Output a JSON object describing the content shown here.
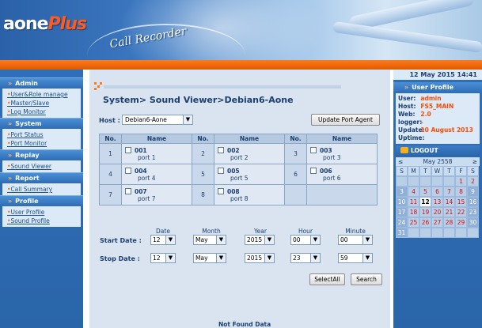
{
  "header": {
    "logo_main": "aone",
    "logo_accent": "Plus",
    "app_title": "Call Recorder",
    "accent_color": "#ff6a00",
    "brand_blue": "#2a65a9"
  },
  "sidebar": {
    "sections": [
      {
        "title": "Admin",
        "links": [
          "User&Role manage",
          "Master/Slave",
          "Log Monitor"
        ]
      },
      {
        "title": "System",
        "links": [
          "Port Status",
          "Port Monitor"
        ]
      },
      {
        "title": "Replay",
        "links": [
          "Sound Viewer"
        ]
      },
      {
        "title": "Report",
        "links": [
          "Call Summary"
        ]
      },
      {
        "title": "Profile",
        "links": [
          "User Profile",
          "Sound Profile"
        ]
      }
    ]
  },
  "main": {
    "breadcrumb": "System> Sound Viewer>Debian6-Aone",
    "host_label": "Host :",
    "host_value": "Debian6-Aone",
    "update_button": "Update Port Agent",
    "table": {
      "col_no": "No.",
      "col_name": "Name",
      "ports": [
        {
          "no": "1",
          "code": "001",
          "label": "port 1"
        },
        {
          "no": "2",
          "code": "002",
          "label": "port 2"
        },
        {
          "no": "3",
          "code": "003",
          "label": "port 3"
        },
        {
          "no": "4",
          "code": "004",
          "label": "port 4"
        },
        {
          "no": "5",
          "code": "005",
          "label": "port 5"
        },
        {
          "no": "6",
          "code": "006",
          "label": "port 6"
        },
        {
          "no": "7",
          "code": "007",
          "label": "port 7"
        },
        {
          "no": "8",
          "code": "008",
          "label": "port 8"
        }
      ]
    },
    "date_headers": {
      "date": "Date",
      "month": "Month",
      "year": "Year",
      "hour": "Hour",
      "minute": "Minute"
    },
    "start": {
      "label": "Start Date :",
      "date": "12",
      "month": "May",
      "year": "2015",
      "hour": "00",
      "minute": "00"
    },
    "stop": {
      "label": "Stop Date :",
      "date": "12",
      "month": "May",
      "year": "2015",
      "hour": "23",
      "minute": "59"
    },
    "select_all_button": "SelectAll",
    "search_button": "Search",
    "not_found": "Not Found Data"
  },
  "rightbar": {
    "date_time": "12 May 2015 14:41",
    "profile_title": "User Profile",
    "profile": [
      {
        "key": "User:",
        "value": "admin"
      },
      {
        "key": "Host:",
        "value": "FS5_MAIN"
      },
      {
        "key": "Web:",
        "value": "2.0"
      },
      {
        "key": "logger:",
        "value": "-"
      },
      {
        "key": "Update:",
        "value": "10 August 2013"
      },
      {
        "key": "Uptime:",
        "value": ""
      }
    ],
    "logout": "LOGOUT",
    "calendar": {
      "prev": "≤",
      "title": "May 2558",
      "next": "≥",
      "days": [
        "S",
        "M",
        "T",
        "W",
        "T",
        "F",
        "S"
      ],
      "cells": [
        "",
        "",
        "",
        "",
        "",
        "1",
        "2",
        "3",
        "4",
        "5",
        "6",
        "7",
        "8",
        "9",
        "10",
        "11",
        "12",
        "13",
        "14",
        "15",
        "16",
        "17",
        "18",
        "19",
        "20",
        "21",
        "22",
        "23",
        "24",
        "25",
        "26",
        "27",
        "28",
        "29",
        "30",
        "31",
        "",
        "",
        "",
        "",
        "",
        ""
      ],
      "today": "12"
    }
  }
}
